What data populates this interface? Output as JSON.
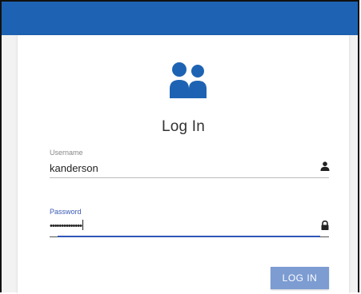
{
  "colors": {
    "top_bar": "#1e63b3",
    "accent": "#2f56b5",
    "button": "#7c9cd2"
  },
  "header": {
    "icon": "users-icon"
  },
  "form": {
    "title": "Log In",
    "username": {
      "label": "Username",
      "value": "kanderson",
      "icon": "person-icon"
    },
    "password": {
      "label": "Password",
      "value": "••••••••••••••",
      "icon": "lock-icon"
    },
    "submit_label": "LOG IN"
  }
}
